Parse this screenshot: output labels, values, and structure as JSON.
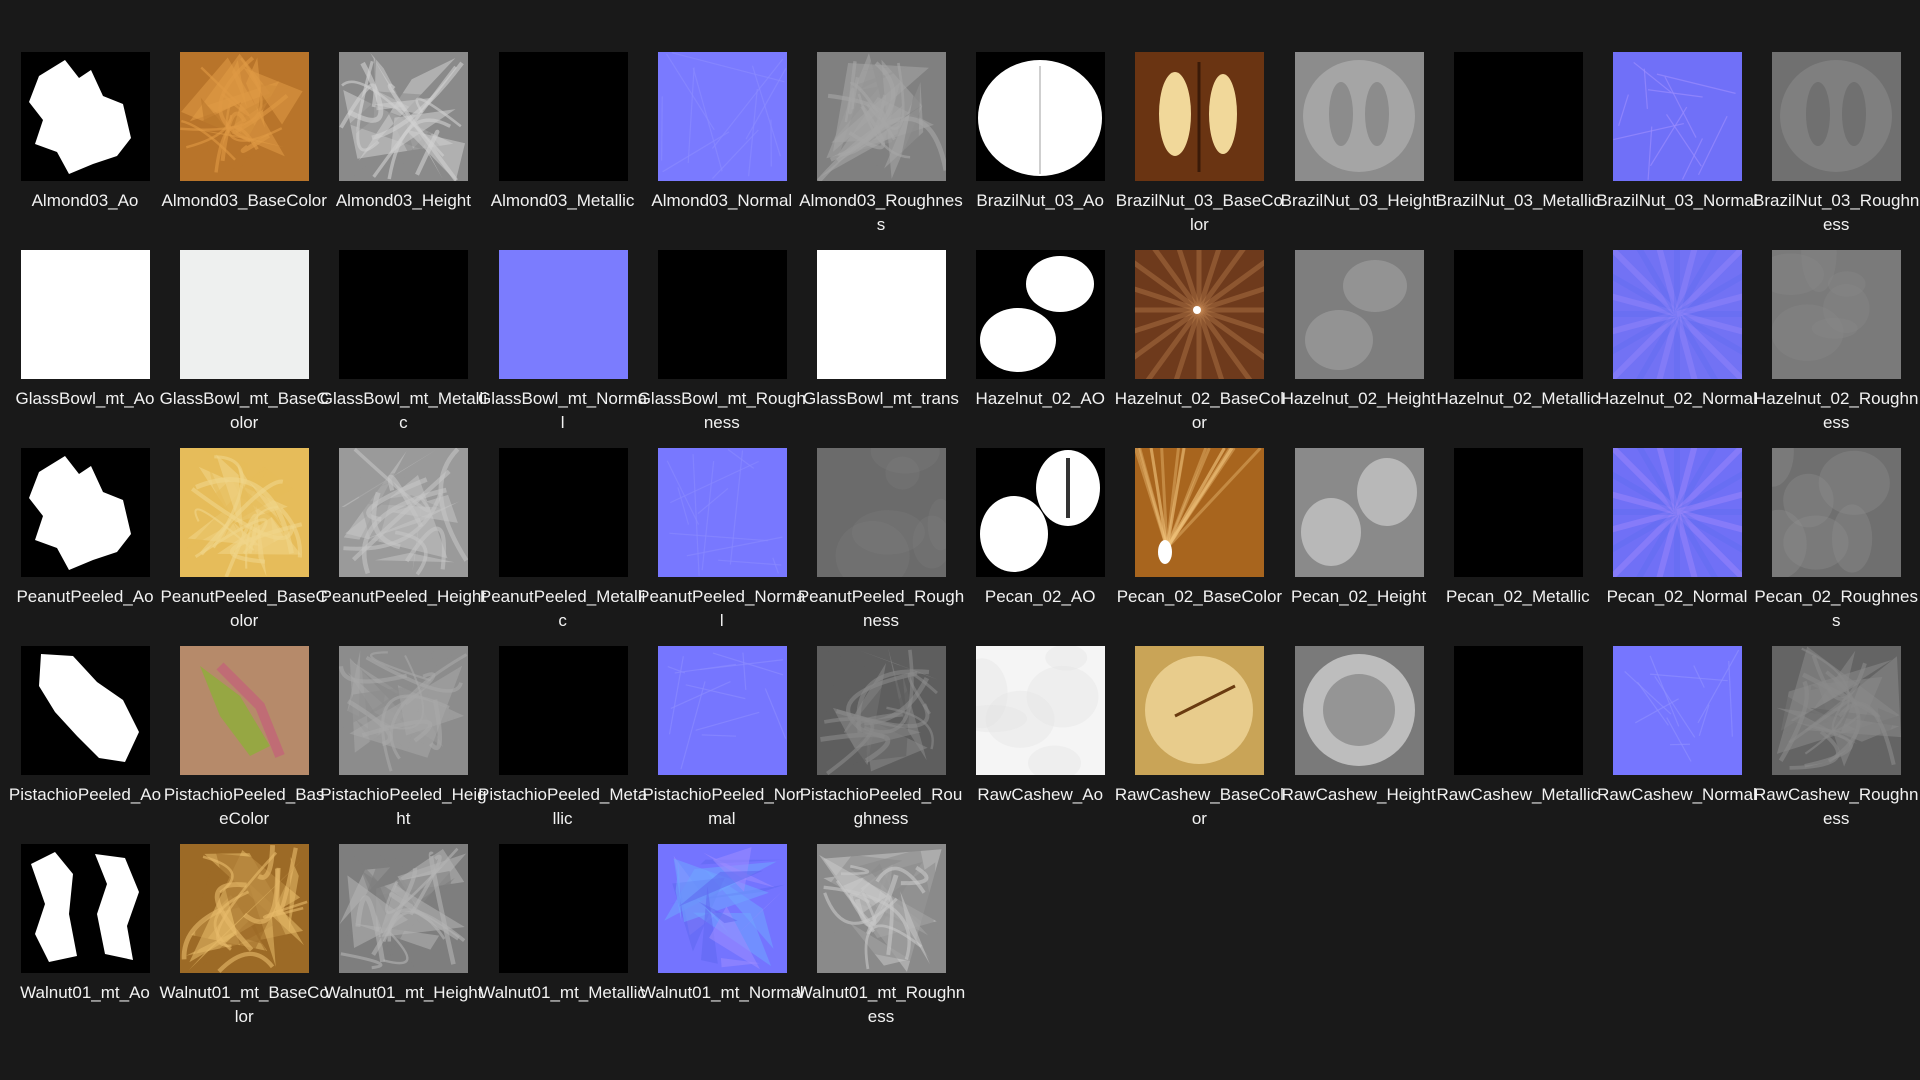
{
  "window": {
    "title": "",
    "background": "#191919"
  },
  "files": [
    {
      "name": "Almond03_Ao",
      "kind": "mask-flake",
      "bg": "#000000",
      "fg": "#ffffff"
    },
    {
      "name": "Almond03_BaseColor",
      "kind": "swirl",
      "bg": "#b8742a",
      "fg": "#e09a45"
    },
    {
      "name": "Almond03_Height",
      "kind": "swirl",
      "bg": "#8a8a8a",
      "fg": "#d0d0d0"
    },
    {
      "name": "Almond03_Metallic",
      "kind": "solid",
      "bg": "#000000",
      "fg": "#000000"
    },
    {
      "name": "Almond03_Normal",
      "kind": "normal",
      "bg": "#7a7aff",
      "fg": "#8a8aff"
    },
    {
      "name": "Almond03_Roughness",
      "kind": "swirl",
      "bg": "#808080",
      "fg": "#a6a6a6"
    },
    {
      "name": "BrazilNut_03_Ao",
      "kind": "mask-split",
      "bg": "#000000",
      "fg": "#ffffff"
    },
    {
      "name": "BrazilNut_03_BaseColor",
      "kind": "split-color",
      "bg": "#6a3412",
      "fg": "#f1d89a"
    },
    {
      "name": "BrazilNut_03_Height",
      "kind": "split-gray",
      "bg": "#8c8c8c",
      "fg": "#bdbdbd"
    },
    {
      "name": "BrazilNut_03_Metallic",
      "kind": "solid",
      "bg": "#000000",
      "fg": "#000000"
    },
    {
      "name": "BrazilNut_03_Normal",
      "kind": "normal",
      "bg": "#7070f8",
      "fg": "#9a8cff"
    },
    {
      "name": "BrazilNut_03_Roughness",
      "kind": "split-gray",
      "bg": "#707070",
      "fg": "#8d8d8d"
    },
    {
      "name": "GlassBowl_mt_Ao",
      "kind": "solid",
      "bg": "#ffffff",
      "fg": "#ffffff"
    },
    {
      "name": "GlassBowl_mt_BaseColor",
      "kind": "solid",
      "bg": "#eef0ef",
      "fg": "#eef0ef"
    },
    {
      "name": "GlassBowl_mt_Metallic",
      "kind": "solid",
      "bg": "#000000",
      "fg": "#000000"
    },
    {
      "name": "GlassBowl_mt_Normal",
      "kind": "solid",
      "bg": "#7b7cfe",
      "fg": "#7b7cfe"
    },
    {
      "name": "GlassBowl_mt_Roughness",
      "kind": "solid",
      "bg": "#000000",
      "fg": "#000000"
    },
    {
      "name": "GlassBowl_mt_trans",
      "kind": "solid",
      "bg": "#ffffff",
      "fg": "#ffffff"
    },
    {
      "name": "Hazelnut_02_AO",
      "kind": "mask-hazel",
      "bg": "#000000",
      "fg": "#ffffff"
    },
    {
      "name": "Hazelnut_02_BaseColor",
      "kind": "hazel-color",
      "bg": "#6e3a1c",
      "fg": "#c88a55"
    },
    {
      "name": "Hazelnut_02_Height",
      "kind": "hazel-gray",
      "bg": "#7e7e7e",
      "fg": "#a2a2a2"
    },
    {
      "name": "Hazelnut_02_Metallic",
      "kind": "solid",
      "bg": "#000000",
      "fg": "#000000"
    },
    {
      "name": "Hazelnut_02_Normal",
      "kind": "normal-rays",
      "bg": "#7272f4",
      "fg": "#a08cff"
    },
    {
      "name": "Hazelnut_02_Roughness",
      "kind": "plain-gray",
      "bg": "#7a7a7a",
      "fg": "#8a8a8a"
    },
    {
      "name": "PeanutPeeled_Ao",
      "kind": "mask-flake",
      "bg": "#000000",
      "fg": "#ffffff"
    },
    {
      "name": "PeanutPeeled_BaseColor",
      "kind": "swirl",
      "bg": "#e6bc5a",
      "fg": "#f0d58b"
    },
    {
      "name": "PeanutPeeled_Height",
      "kind": "swirl",
      "bg": "#9a9a9a",
      "fg": "#c4c4c4"
    },
    {
      "name": "PeanutPeeled_Metallic",
      "kind": "solid",
      "bg": "#000000",
      "fg": "#000000"
    },
    {
      "name": "PeanutPeeled_Normal",
      "kind": "normal",
      "bg": "#7878ff",
      "fg": "#8888ff"
    },
    {
      "name": "PeanutPeeled_Roughness",
      "kind": "plain-gray",
      "bg": "#6b6b6b",
      "fg": "#7a7a7a"
    },
    {
      "name": "Pecan_02_AO",
      "kind": "mask-pecan",
      "bg": "#000000",
      "fg": "#ffffff"
    },
    {
      "name": "Pecan_02_BaseColor",
      "kind": "pecan-color",
      "bg": "#a8651e",
      "fg": "#f0c27a"
    },
    {
      "name": "Pecan_02_Height",
      "kind": "pecan-gray",
      "bg": "#8a8a8a",
      "fg": "#b8b8b8"
    },
    {
      "name": "Pecan_02_Metallic",
      "kind": "solid",
      "bg": "#000000",
      "fg": "#000000"
    },
    {
      "name": "Pecan_02_Normal",
      "kind": "normal-rays",
      "bg": "#7070f6",
      "fg": "#b090ff"
    },
    {
      "name": "Pecan_02_Roughness",
      "kind": "plain-gray",
      "bg": "#6f6f6f",
      "fg": "#8f8f8f"
    },
    {
      "name": "PistachioPeeled_Ao",
      "kind": "mask-pist",
      "bg": "#000000",
      "fg": "#ffffff"
    },
    {
      "name": "PistachioPeeled_BaseColor",
      "kind": "pist-color",
      "bg": "#b68a6a",
      "fg": "#8fae3a"
    },
    {
      "name": "PistachioPeeled_Height",
      "kind": "swirl",
      "bg": "#8c8c8c",
      "fg": "#a8a8a8"
    },
    {
      "name": "PistachioPeeled_Metallic",
      "kind": "solid",
      "bg": "#000000",
      "fg": "#000000"
    },
    {
      "name": "PistachioPeeled_Normal",
      "kind": "normal",
      "bg": "#7676ff",
      "fg": "#8a8aff"
    },
    {
      "name": "PistachioPeeled_Roughness",
      "kind": "swirl",
      "bg": "#5e5e5e",
      "fg": "#8a8a8a"
    },
    {
      "name": "RawCashew_Ao",
      "kind": "plain-gray",
      "bg": "#f5f5f5",
      "fg": "#e2e2e2"
    },
    {
      "name": "RawCashew_BaseColor",
      "kind": "cashew-color",
      "bg": "#c9a457",
      "fg": "#f0d69a"
    },
    {
      "name": "RawCashew_Height",
      "kind": "cashew-gray",
      "bg": "#7a7a7a",
      "fg": "#bdbdbd"
    },
    {
      "name": "RawCashew_Metallic",
      "kind": "solid",
      "bg": "#000000",
      "fg": "#000000"
    },
    {
      "name": "RawCashew_Normal",
      "kind": "normal",
      "bg": "#7676ff",
      "fg": "#8e8eff"
    },
    {
      "name": "RawCashew_Roughness",
      "kind": "swirl",
      "bg": "#646464",
      "fg": "#8a8a8a"
    },
    {
      "name": "Walnut01_mt_Ao",
      "kind": "mask-walnut",
      "bg": "#000000",
      "fg": "#ffffff"
    },
    {
      "name": "Walnut01_mt_BaseColor",
      "kind": "swirl",
      "bg": "#9c6a26",
      "fg": "#e8bb6a"
    },
    {
      "name": "Walnut01_mt_Height",
      "kind": "swirl",
      "bg": "#7e7e7e",
      "fg": "#b4b4b4"
    },
    {
      "name": "Walnut01_mt_Metallic",
      "kind": "solid",
      "bg": "#000000",
      "fg": "#000000"
    },
    {
      "name": "Walnut01_mt_Normal",
      "kind": "normal-poly",
      "bg": "#7474ff",
      "fg": "#a0a0ff"
    },
    {
      "name": "Walnut01_mt_Roughness",
      "kind": "swirl",
      "bg": "#8a8a8a",
      "fg": "#c8c8c8"
    }
  ],
  "files_grid_columns": 12
}
